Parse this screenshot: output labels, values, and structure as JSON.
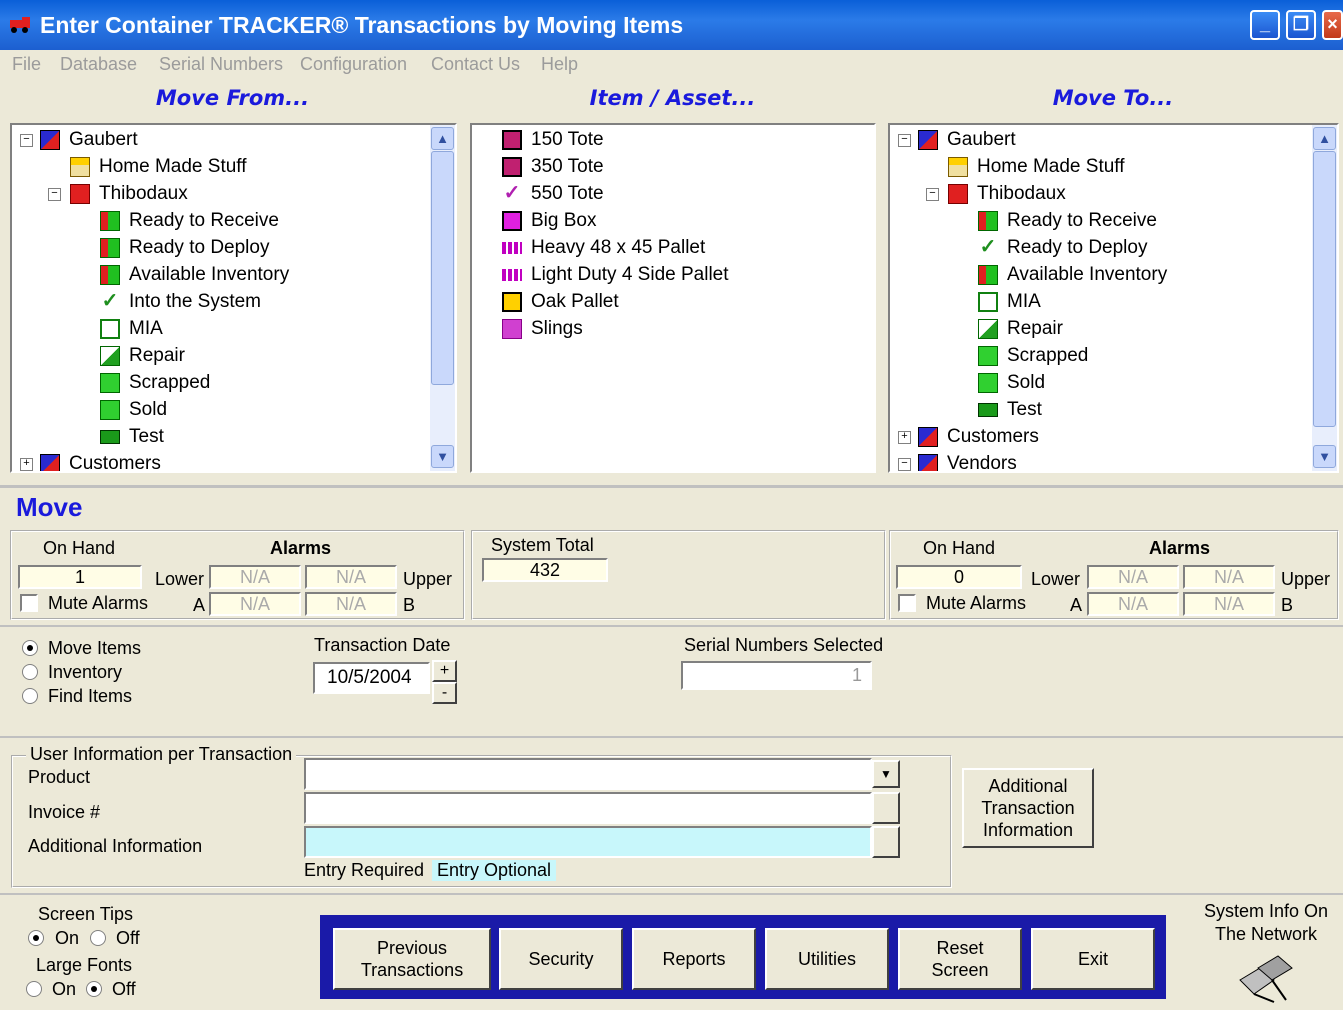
{
  "window": {
    "title": "Enter Container TRACKER® Transactions by Moving Items"
  },
  "menu": [
    "File",
    "Database",
    "Serial Numbers",
    "Configuration",
    "Contact Us",
    "Help"
  ],
  "panels": {
    "from": "Move From...",
    "item": "Item / Asset...",
    "to": "Move To..."
  },
  "move_from": [
    "Gaubert",
    "Home Made Stuff",
    "Thibodaux",
    "Ready to Receive",
    "Ready to Deploy",
    "Available Inventory",
    "Into the System",
    "MIA",
    "Repair",
    "Scrapped",
    "Sold",
    "Test",
    "Customers"
  ],
  "items": [
    "150 Tote",
    "350 Tote",
    "550 Tote",
    "Big Box",
    "Heavy 48 x 45 Pallet",
    "Light Duty 4 Side Pallet",
    "Oak Pallet",
    "Slings"
  ],
  "move_to": [
    "Gaubert",
    "Home Made Stuff",
    "Thibodaux",
    "Ready to Receive",
    "Ready to Deploy",
    "Available Inventory",
    "MIA",
    "Repair",
    "Scrapped",
    "Sold",
    "Test",
    "Customers",
    "Vendors"
  ],
  "move": {
    "heading": "Move",
    "on_hand_label": "On Hand",
    "alarms_label": "Alarms",
    "lower": "Lower",
    "upper": "Upper",
    "a": "A",
    "b": "B",
    "mute": "Mute Alarms",
    "na": "N/A",
    "from_on_hand": "1",
    "to_on_hand": "0",
    "system_total_label": "System Total",
    "system_total": "432"
  },
  "mode": {
    "move_items": "Move Items",
    "inventory": "Inventory",
    "find_items": "Find Items"
  },
  "transaction_date_label": "Transaction Date",
  "transaction_date": "10/5/2004",
  "spin_up": "+",
  "spin_down": "-",
  "serial_label": "Serial Numbers Selected",
  "serial_count": "1",
  "user_info": {
    "legend": "User Information per Transaction",
    "product": "Product",
    "invoice": "Invoice #",
    "additional": "Additional Information",
    "entry_required": "Entry Required",
    "entry_optional": "Entry Optional",
    "additional_button": "Additional Transaction Information"
  },
  "screen_tips": "Screen Tips",
  "large_fonts": "Large Fonts",
  "on": "On",
  "off": "Off",
  "buttons": {
    "previous": "Previous Transactions",
    "security": "Security",
    "reports": "Reports",
    "utilities": "Utilities",
    "reset": "Reset Screen",
    "exit": "Exit"
  },
  "system_info": "System Info On The Network",
  "colors": {
    "title_blue": "#0a5fd8",
    "panel_title": "#1a1adc",
    "button_bar": "#1a1aa8",
    "optional_field": "#c8f7fb"
  }
}
